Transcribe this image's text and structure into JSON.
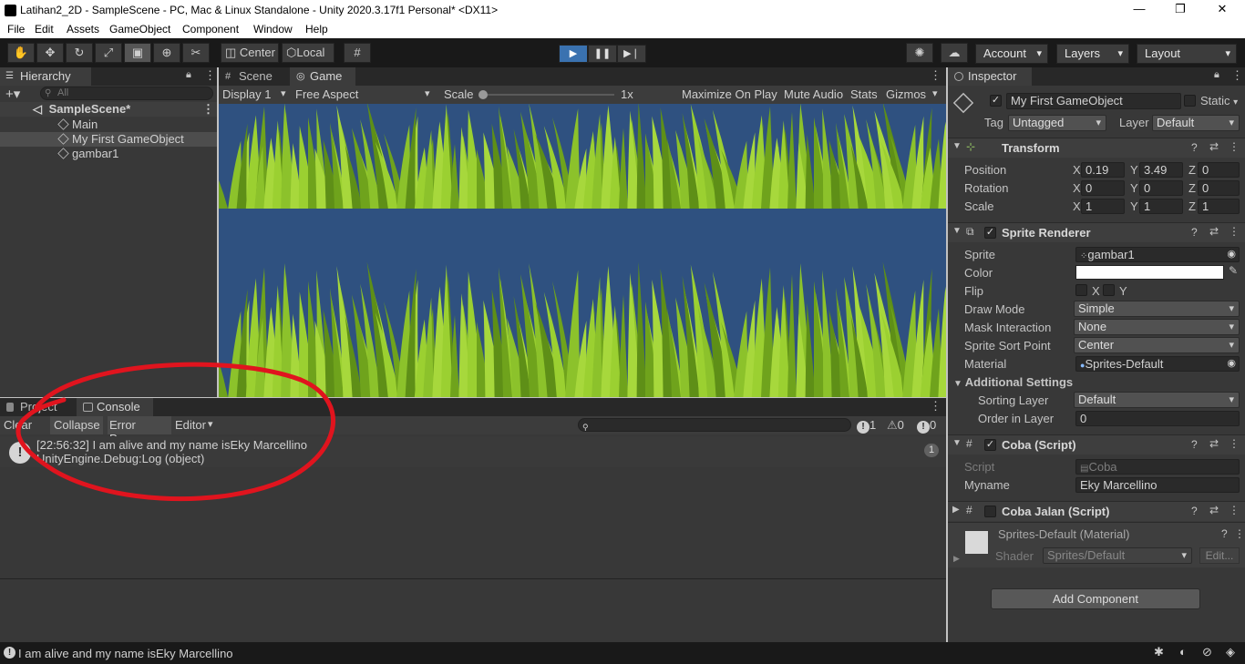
{
  "window": {
    "title": "Latihan2_2D - SampleScene - PC, Mac & Linux Standalone - Unity 2020.3.17f1 Personal* <DX11>",
    "minimize": "—",
    "restore": "❐",
    "close": "✕"
  },
  "menu": [
    "File",
    "Edit",
    "Assets",
    "GameObject",
    "Component",
    "Window",
    "Help"
  ],
  "toolbar": {
    "pivot": "Center",
    "space": "Local",
    "account": "Account",
    "layers": "Layers",
    "layout": "Layout",
    "tools": [
      "hand-tool-icon",
      "move-tool-icon",
      "rotate-tool-icon",
      "scale-tool-icon",
      "rect-tool-icon",
      "transform-tool-icon",
      "custom-tool-icon"
    ]
  },
  "hierarchy": {
    "tab": "Hierarchy",
    "search_placeholder": "All",
    "scene": "SampleScene*",
    "items": [
      "Main",
      "My First GameObject",
      "gambar1"
    ]
  },
  "game": {
    "tabs": [
      "Scene",
      "Game"
    ],
    "display": "Display 1",
    "aspect": "Free Aspect",
    "scale_label": "Scale",
    "scale_value": "1x",
    "options": [
      "Maximize On Play",
      "Mute Audio",
      "Stats",
      "Gizmos"
    ],
    "background": "#2f5180",
    "grass": "#8cc22b"
  },
  "console": {
    "tabs": [
      "Project",
      "Console"
    ],
    "buttons": [
      "Clear",
      "Collapse",
      "Error Pause",
      "Editor"
    ],
    "counts": {
      "log": "1",
      "warn": "0",
      "error": "0"
    },
    "entry_line1": "[22:56:32] I am alive and my name isEky Marcellino",
    "entry_line2": "UnityEngine.Debug:Log (object)",
    "entry_count": "1"
  },
  "inspector": {
    "tab": "Inspector",
    "name": "My First GameObject",
    "static": "Static",
    "tag_label": "Tag",
    "tag": "Untagged",
    "layer_label": "Layer",
    "layer": "Default",
    "transform": {
      "title": "Transform",
      "position": {
        "label": "Position",
        "x": "0.19",
        "y": "3.49",
        "z": "0"
      },
      "rotation": {
        "label": "Rotation",
        "x": "0",
        "y": "0",
        "z": "0"
      },
      "scale": {
        "label": "Scale",
        "x": "1",
        "y": "1",
        "z": "1"
      }
    },
    "sprite_renderer": {
      "title": "Sprite Renderer",
      "sprite_label": "Sprite",
      "sprite": "gambar1",
      "color_label": "Color",
      "flip_label": "Flip",
      "flip_x": "X",
      "flip_y": "Y",
      "draw_mode_label": "Draw Mode",
      "draw_mode": "Simple",
      "mask_label": "Mask Interaction",
      "mask": "None",
      "sort_point_label": "Sprite Sort Point",
      "sort_point": "Center",
      "material_label": "Material",
      "material": "Sprites-Default",
      "additional": "Additional Settings",
      "sorting_layer_label": "Sorting Layer",
      "sorting_layer": "Default",
      "order_label": "Order in Layer",
      "order": "0"
    },
    "coba": {
      "title": "Coba (Script)",
      "script_label": "Script",
      "script": "Coba",
      "myname_label": "Myname",
      "myname": "Eky Marcellino"
    },
    "coba_jalan": {
      "title": "Coba Jalan (Script)"
    },
    "material": {
      "name": "Sprites-Default (Material)",
      "shader_label": "Shader",
      "shader": "Sprites/Default",
      "edit": "Edit..."
    },
    "add_component": "Add Component"
  },
  "axes": {
    "x": "X",
    "y": "Y",
    "z": "Z"
  },
  "status": {
    "message": "I am alive and my name isEky Marcellino"
  },
  "annotation_color": "#e0141e"
}
